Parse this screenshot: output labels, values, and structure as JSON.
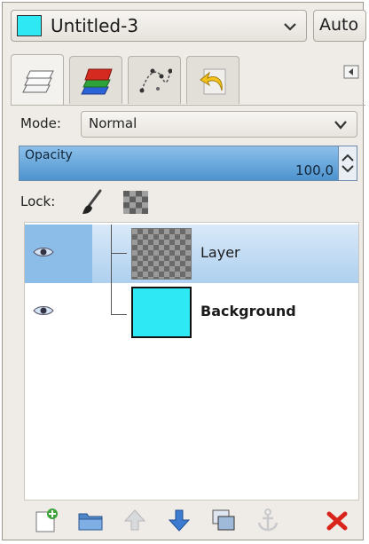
{
  "image_selector": {
    "name": "Untitled-3",
    "swatch_color": "#2ee9f4",
    "chevron_icon": "chevron-down-icon"
  },
  "auto_button": {
    "label": "Auto"
  },
  "tabs": [
    {
      "name": "layers",
      "icon": "layers-icon",
      "active": true
    },
    {
      "name": "channels",
      "icon": "channels-icon",
      "active": false
    },
    {
      "name": "paths",
      "icon": "paths-icon",
      "active": false
    },
    {
      "name": "undo-history",
      "icon": "undo-history-icon",
      "active": false
    }
  ],
  "mode": {
    "label": "Mode:",
    "value": "Normal"
  },
  "opacity": {
    "label": "Opacity",
    "value": "100,0",
    "fraction": 1.0
  },
  "lock": {
    "label": "Lock:"
  },
  "layers": [
    {
      "name": "Layer",
      "visible": true,
      "selected": true,
      "thumbnail": "transparent-checker"
    },
    {
      "name": "Background",
      "visible": true,
      "selected": false,
      "thumbnail": "#2ee9f4"
    }
  ],
  "toolbar": [
    "new-layer-icon",
    "new-layer-group-icon",
    "raise-layer-icon",
    "lower-layer-icon",
    "duplicate-layer-icon",
    "anchor-layer-icon",
    "delete-layer-icon"
  ],
  "colors": {
    "accent": "#4d93cf",
    "selection": "#aed0ef",
    "swatch": "#2ee9f4",
    "delete": "#d8241b"
  }
}
